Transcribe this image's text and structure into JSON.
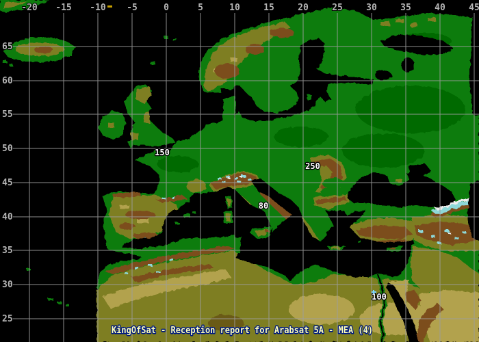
{
  "title": "KingOfSat - Reception report for Arabsat 5A - MEA (4)",
  "axis": {
    "top": [
      "-20",
      "-15",
      "-10",
      "-5",
      "0",
      "5",
      "10",
      "15",
      "20",
      "25",
      "30",
      "35",
      "40",
      "45"
    ],
    "left": [
      "65",
      "60",
      "55",
      "50",
      "45",
      "40",
      "35",
      "30",
      "25"
    ]
  },
  "map_labels": [
    "150",
    "250",
    "80",
    "100"
  ],
  "colors": {
    "ocean": "#000000",
    "lowland": "#087c08",
    "lowland_dark": "#045c04",
    "upland": "#7e7e22",
    "highland": "#7c4d1d",
    "desert": "#b2a24e",
    "desert_dark": "#6b5a14",
    "glacier": "#8ed8d8",
    "peak": "#eeeeee",
    "grid": "#9e9e9e",
    "axis_text": "#b4b4b4",
    "label_text": "#ffffff",
    "title_text": "#ffffb4",
    "title_shadow": "#001a80",
    "marker": "#7fd7ff",
    "marker2": "#c8a000"
  }
}
